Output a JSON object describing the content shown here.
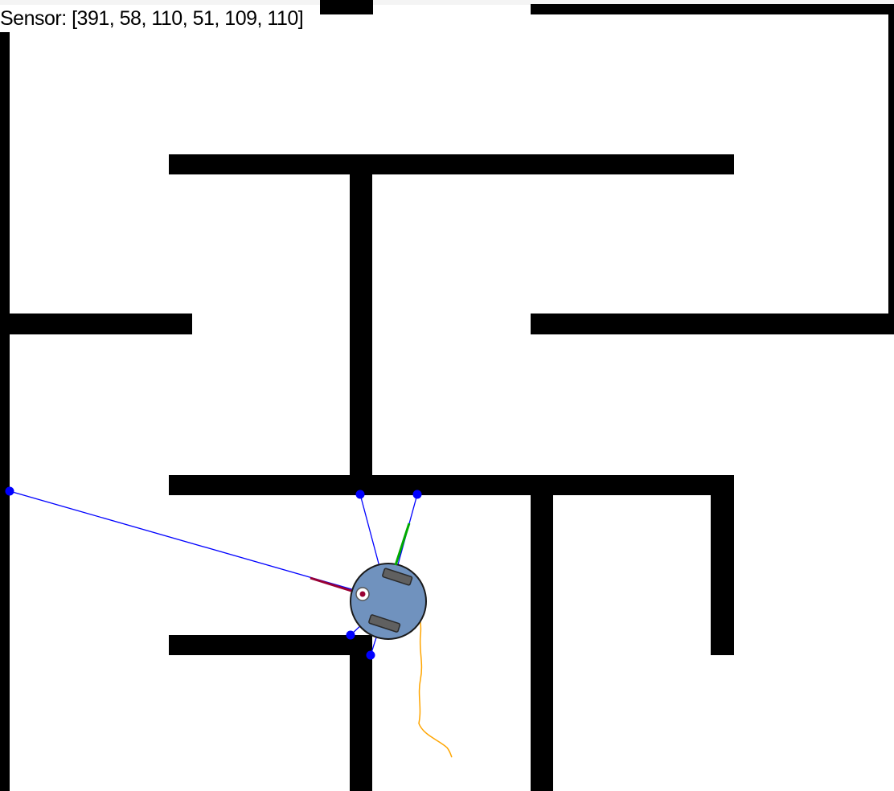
{
  "sensor": {
    "label": "Sensor:",
    "values": [
      391,
      58,
      110,
      51,
      109,
      110
    ],
    "text": "Sensor: [391, 58, 110, 51, 109, 110]"
  },
  "colors": {
    "background": "#ffffff",
    "wall": "#000000",
    "robot_body": "#7092be",
    "robot_outline": "#1a1a1a",
    "wheel": "#606060",
    "sensor_ray": "#0000ff",
    "sensor_hit": "#0000ff",
    "heading_indicator": "#00aa00",
    "rear_indicator": "#990033",
    "trail": "#ffa500",
    "marker_fill": "#ffffff",
    "marker_dot": "#990033"
  },
  "icons": {
    "robot": "round-robot-icon",
    "sensor_hit": "filled-circle-dot"
  }
}
